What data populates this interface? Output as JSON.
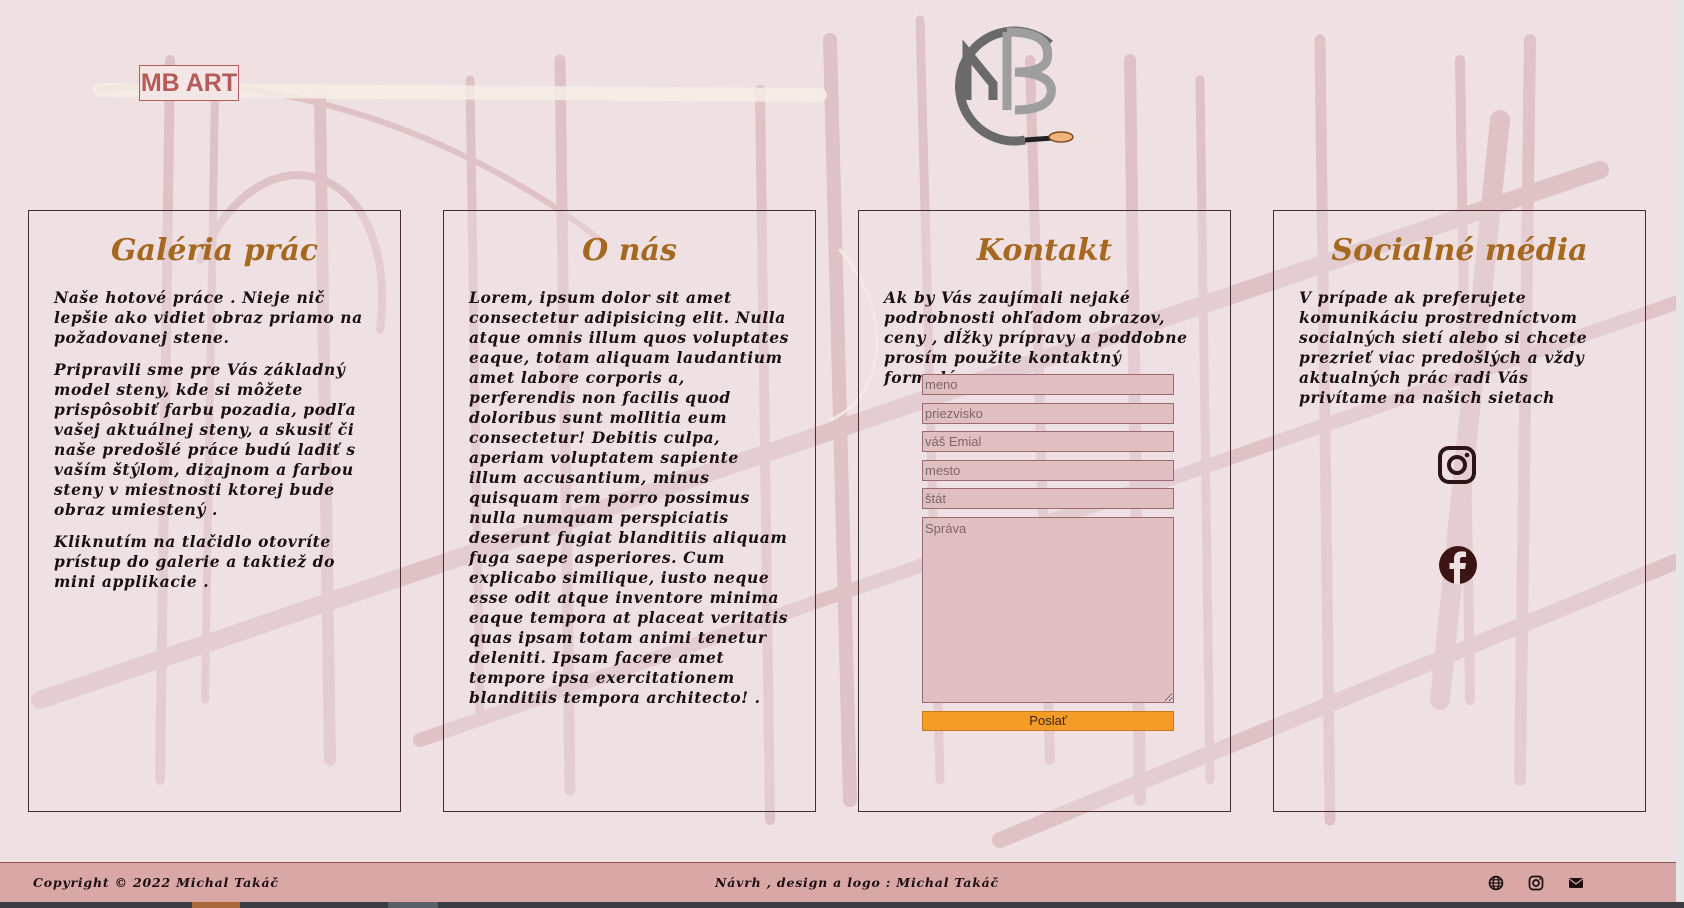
{
  "header": {
    "logo_text": "MB ART",
    "brand_logo_letters": "MB"
  },
  "cards": [
    {
      "title": "Galéria prác",
      "paragraphs": [
        "Naše hotové práce . Nieje nič lepšie ako vidiet obraz priamo na požadovanej stene.",
        "Pripravili sme pre Vás základný model steny, kde si môžete prispôsobiť farbu pozadia, podľa vašej aktuálnej steny, a skusiť či naše predošlé práce budú ladiť s vaším štýlom, dizajnom a farbou steny v miestnosti ktorej bude obraz umiestený .",
        "Kliknutím na tlačidlo otovríte prístup do galerie a taktiež do mini applikacie ."
      ]
    },
    {
      "title": "O nás",
      "paragraphs": [
        "Lorem, ipsum dolor sit amet consectetur adipisicing elit. Nulla atque omnis illum quos voluptates eaque, totam aliquam laudantium amet labore corporis a, perferendis non facilis quod doloribus sunt mollitia eum consectetur! Debitis culpa, aperiam voluptatem sapiente illum accusantium, minus quisquam rem porro possimus nulla numquam perspiciatis deserunt fugiat blanditiis aliquam fuga saepe asperiores. Cum explicabo similique, iusto neque esse odit atque inventore minima eaque tempora at placeat veritatis quas ipsam totam animi tenetur deleniti. Ipsam facere amet tempore ipsa exercitationem blanditiis tempora architecto! ."
      ]
    },
    {
      "title": "Kontakt",
      "paragraphs": [
        "Ak by Vás zaujímali nejaké podrobnosti ohľadom obrazov, ceny , dĺžky prípravy a poddobne prosím použite kontaktný formulár"
      ]
    },
    {
      "title": "Socialné média",
      "paragraphs": [
        "V prípade ak preferujete komunikáciu prostredníctvom socialných sietí alebo si chcete prezrieť viac predošlých a vždy aktualných prác radi Vás privítame na našich sietach"
      ]
    }
  ],
  "form": {
    "fields": [
      {
        "placeholder": "meno",
        "value": ""
      },
      {
        "placeholder": "priezvisko",
        "value": ""
      },
      {
        "placeholder": "váš Emial",
        "value": ""
      },
      {
        "placeholder": "mesto",
        "value": ""
      },
      {
        "placeholder": "štát",
        "value": ""
      }
    ],
    "message_placeholder": "Správa",
    "submit_label": "Poslať"
  },
  "social": {
    "icons": [
      "instagram-icon",
      "facebook-icon"
    ]
  },
  "footer": {
    "copyright": "Copyright © 2022 Michal Takáč",
    "design_credit": "Návrh , design a logo : Michal Takáč",
    "icons": [
      "globe-icon",
      "instagram-icon",
      "envelope-icon"
    ]
  },
  "colors": {
    "background": "#efe1e2",
    "heading": "#a5681f",
    "footer": "#d9a7a6",
    "submit": "#f39c28",
    "logo_text": "#b65a5a",
    "input_bg": "#e0bfc3"
  }
}
